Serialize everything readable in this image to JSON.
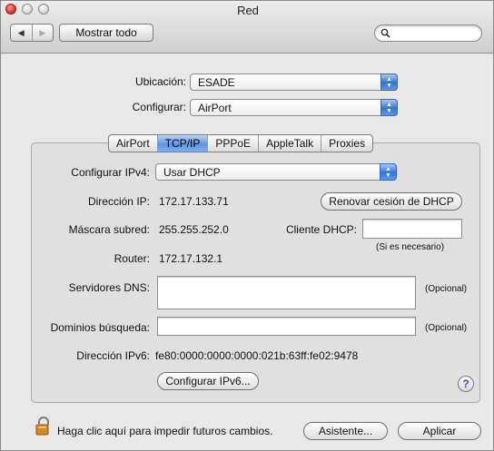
{
  "window": {
    "title": "Red"
  },
  "toolbar": {
    "back_glyph": "◀",
    "forward_glyph": "▶",
    "show_all_label": "Mostrar todo",
    "search_icon": "search-icon",
    "search_value": ""
  },
  "location": {
    "label": "Ubicación:",
    "value": "ESADE"
  },
  "configure": {
    "label": "Configurar:",
    "value": "AirPort"
  },
  "tabs": [
    "AirPort",
    "TCP/IP",
    "PPPoE",
    "AppleTalk",
    "Proxies"
  ],
  "active_tab": "TCP/IP",
  "tcpip": {
    "ipv4_label": "Configurar IPv4:",
    "ipv4_value": "Usar DHCP",
    "ip_label": "Dirección IP:",
    "ip_value": "172.17.133.71",
    "renew_button": "Renovar cesión de DHCP",
    "mask_label": "Máscara subred:",
    "mask_value": "255.255.252.0",
    "dhcp_client_label": "Cliente DHCP:",
    "dhcp_client_value": "",
    "dhcp_client_hint": "(Si es necesario)",
    "router_label": "Router:",
    "router_value": "172.17.132.1",
    "dns_label": "Servidores DNS:",
    "dns_value": "",
    "dns_hint": "(Opcional)",
    "search_domains_label": "Dominios búsqueda:",
    "search_domains_value": "",
    "search_domains_hint": "(Opcional)",
    "ipv6_label": "Dirección IPv6:",
    "ipv6_value": "fe80:0000:0000:0000:021b:63ff:fe02:9478",
    "configure_ipv6_button": "Configurar IPv6...",
    "help_glyph": "?"
  },
  "footer": {
    "lock_text": "Haga clic aquí para impedir futuros cambios.",
    "assistant_button": "Asistente...",
    "apply_button": "Aplicar"
  },
  "colors": {
    "accent": "#3b7fe0",
    "window_bg": "#e8e8e8"
  }
}
